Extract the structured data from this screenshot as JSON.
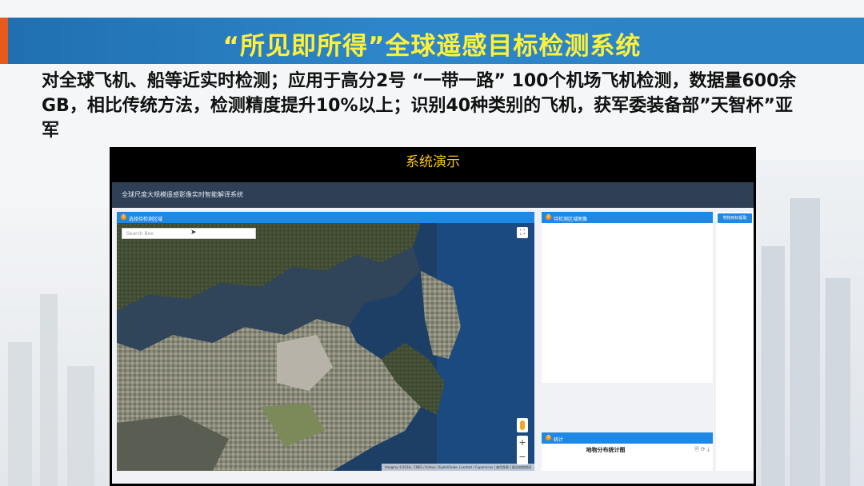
{
  "slide": {
    "banner_title": "“所见即所得”全球遥感目标检测系统",
    "description": "对全球飞机、船等近实时检测；应用于高分2号 “一带一路” 100个机场飞机检测，数据量600余GB，相比传统方法，检测精度提升10%以上；识别40种类别的飞机，获军委装备部”天智杯”亚军",
    "demo_title": "系统演示",
    "colors": {
      "banner": "#2d86c9",
      "banner_title": "#fff03a",
      "demo_title": "#f5c518"
    }
  },
  "app": {
    "title": "全球尺度大规模遥感影像实时智能解译系统",
    "panels": {
      "select_region": {
        "num": "1",
        "label": "选择待检测区域"
      },
      "region_image": {
        "num": "2",
        "label": "待检测区域图像"
      },
      "stats": {
        "num": "3",
        "label": "统计"
      }
    },
    "search": {
      "placeholder": "Search Box"
    },
    "map": {
      "zoom_in": "+",
      "zoom_out": "−",
      "fullscreen": "⛶",
      "attribution": "Imagery ©2018，CNES / Airbus, DigitalGlobe, Landsat / Copernicus | 使用条款 | 报告地图错误"
    },
    "stats_chart_title": "地物分布统计图",
    "stats_icons": "🗎 ⟳ ⤓",
    "side_button": "地物目标提取"
  }
}
